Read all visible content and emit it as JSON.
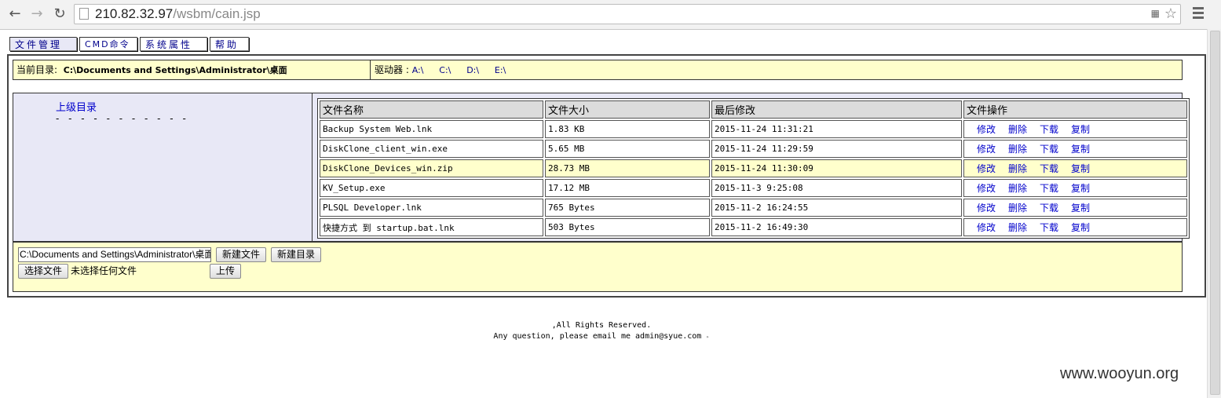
{
  "browser": {
    "url_host": "210.82.32.97",
    "url_path": "/wsbm/cain.jsp"
  },
  "tabs": [
    {
      "label": "文件管理"
    },
    {
      "label": "CMD命令"
    },
    {
      "label": "系统属性"
    },
    {
      "label": "帮助"
    }
  ],
  "dir_bar": {
    "current_label": "当前目录:",
    "current_path": "C:\\Documents and Settings\\Administrator\\桌面",
    "drives_label": "驱动器 :",
    "drives": [
      "A:\\",
      "C:\\",
      "D:\\",
      "E:\\"
    ]
  },
  "left_pane": {
    "parent_link": "上级目录",
    "dashes": "- - - - - - - - - - -"
  },
  "table": {
    "headers": [
      "文件名称",
      "文件大小",
      "最后修改",
      "文件操作"
    ],
    "ops": [
      "修改",
      "删除",
      "下载",
      "复制"
    ],
    "rows": [
      {
        "name": "Backup System Web.lnk",
        "size": "1.83 KB",
        "modified": "2015-11-24 11:31:21"
      },
      {
        "name": "DiskClone_client_win.exe",
        "size": "5.65 MB",
        "modified": "2015-11-24 11:29:59"
      },
      {
        "name": "DiskClone_Devices_win.zip",
        "size": "28.73 MB",
        "modified": "2015-11-24 11:30:09"
      },
      {
        "name": "KV_Setup.exe",
        "size": "17.12 MB",
        "modified": "2015-11-3 9:25:08"
      },
      {
        "name": "PLSQL Developer.lnk",
        "size": "765 Bytes",
        "modified": "2015-11-2 16:24:55"
      },
      {
        "name": "快捷方式 到 startup.bat.lnk",
        "size": "503 Bytes",
        "modified": "2015-11-2 16:49:30"
      }
    ]
  },
  "bottom": {
    "path_value": "C:\\Documents and Settings\\Administrator\\桌面",
    "new_file": "新建文件",
    "new_dir": "新建目录",
    "choose_file": "选择文件",
    "no_file": "未选择任何文件",
    "upload": "上传"
  },
  "footer": {
    "line1": ",All Rights Reserved.",
    "line2": "Any question, please email me admin@syue.com",
    "line2_tail": "▸"
  },
  "watermark": "www.wooyun.org"
}
